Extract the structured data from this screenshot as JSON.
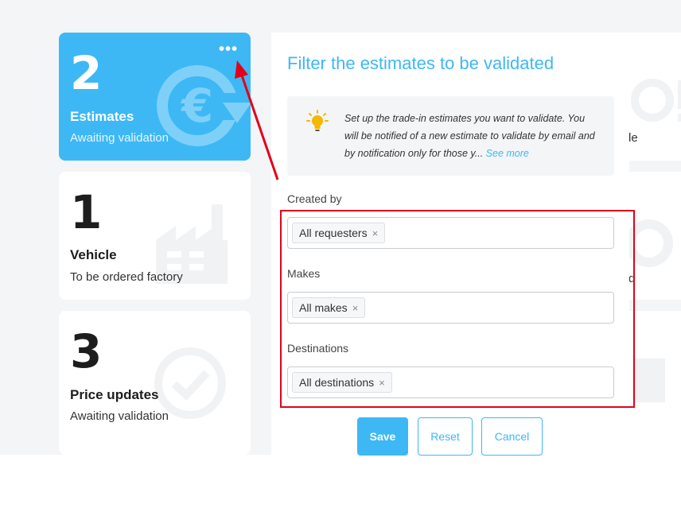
{
  "cards": [
    {
      "number": "2",
      "title": "Estimates",
      "subtitle": "Awaiting validation",
      "active": true,
      "icon": "euro-refresh-icon",
      "menu_label": "•••"
    },
    {
      "number": "1",
      "title": "Vehicle",
      "subtitle": "To be ordered factory",
      "active": false,
      "icon": "factory-icon"
    },
    {
      "number": "3",
      "title": "Price updates",
      "subtitle": "Awaiting validation",
      "active": false,
      "icon": "check-refresh-icon"
    }
  ],
  "right_cards": [
    {
      "fragment": "le",
      "icon": "alert-icon"
    },
    {
      "fragment": "d",
      "icon": "gear-icon"
    },
    {
      "fragment": "",
      "icon": "document-icon"
    }
  ],
  "panel": {
    "title": "Filter the estimates to be validated",
    "info_text": "Set up the trade-in estimates you want to validate. You will be notified of a new estimate to validate by email and by notification only for those y...",
    "see_more": "See more",
    "info_icon": "lightbulb-icon",
    "fields": [
      {
        "label": "Created by",
        "tag": "All requesters",
        "remove": "×"
      },
      {
        "label": "Makes",
        "tag": "All makes",
        "remove": "×"
      },
      {
        "label": "Destinations",
        "tag": "All destinations",
        "remove": "×"
      }
    ],
    "buttons": {
      "save": "Save",
      "reset": "Reset",
      "cancel": "Cancel"
    }
  },
  "annotation": {
    "highlight_color": "#e3001b",
    "arrow_color": "#e3001b"
  },
  "colors": {
    "accent": "#3db8f5",
    "background": "#f4f5f7"
  }
}
